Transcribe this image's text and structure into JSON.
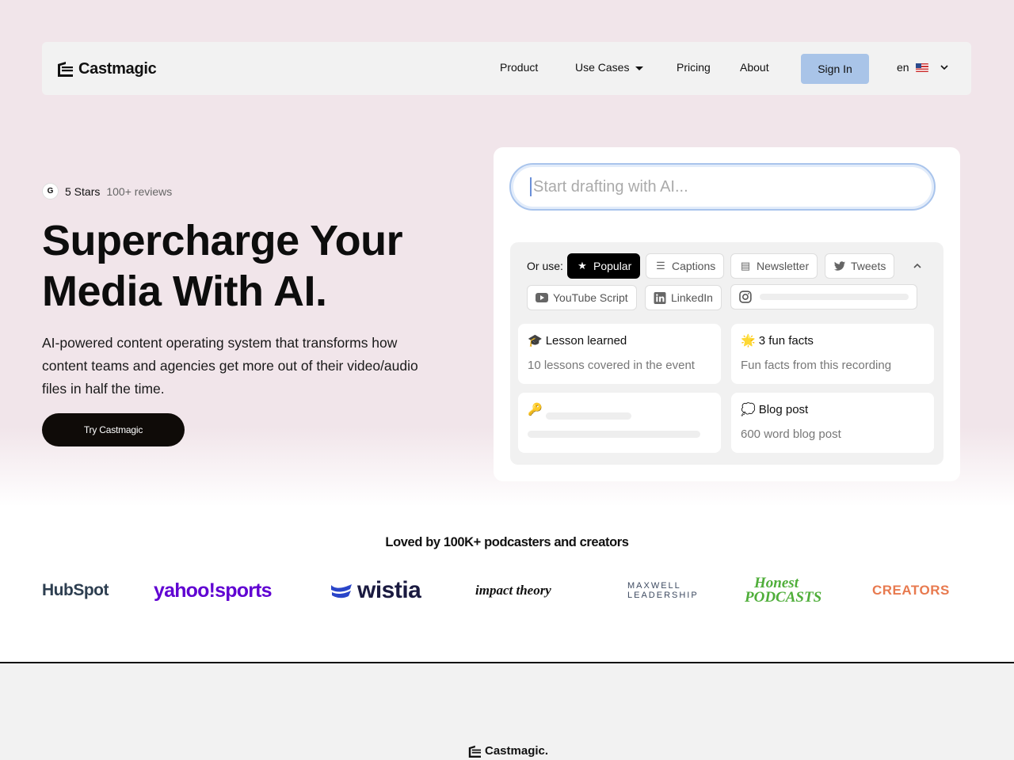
{
  "nav": {
    "logo_text": "Castmagic",
    "links": [
      "Product",
      "Use Cases",
      "Pricing",
      "About"
    ],
    "signin_label": "Sign In",
    "language": "en"
  },
  "hero": {
    "rating_badge": "G",
    "rating_stars": "5 Stars",
    "rating_reviews": "100+ reviews",
    "headline_line1": "Supercharge Your",
    "headline_line2": "Media With AI.",
    "subtext": "AI-powered content operating system that transforms how content teams and agencies get more out of their video/audio files in half the time.",
    "cta_label": "Try Castmagic"
  },
  "composer": {
    "input_placeholder": "Start drafting with AI...",
    "or_use_label": "Or use:",
    "chips": [
      {
        "label": "Popular",
        "icon": "star-icon",
        "active": true
      },
      {
        "label": "Captions",
        "icon": "lines-icon",
        "active": false
      },
      {
        "label": "Newsletter",
        "icon": "newsletter-icon",
        "active": false
      },
      {
        "label": "Tweets",
        "icon": "twitter-icon",
        "active": false
      },
      {
        "label": "YouTube Script",
        "icon": "youtube-icon",
        "active": false
      },
      {
        "label": "LinkedIn",
        "icon": "linkedin-icon",
        "active": false
      },
      {
        "label": "",
        "icon": "instagram-icon",
        "active": false
      }
    ],
    "templates": [
      {
        "emoji": "🎓",
        "title": "Lesson learned",
        "desc": "10 lessons covered in the event"
      },
      {
        "emoji": "🌟",
        "title": "3 fun facts",
        "desc": "Fun facts from this recording"
      },
      {
        "emoji": "🔑",
        "title": "",
        "desc": ""
      },
      {
        "emoji": "💭",
        "title": "Blog post",
        "desc": "600 word blog post"
      }
    ]
  },
  "social_proof": {
    "heading": "Loved by 100K+ podcasters and creators",
    "brands": [
      "HubSpot",
      "yahoo!sports",
      "wistia",
      "impact theory",
      "MAXWELL LEADERSHIP",
      "Honest PODCASTS",
      "CREATORS"
    ]
  },
  "footer": {
    "logo_text": "Castmagic."
  },
  "colors": {
    "hero_bg": "#f1e5ea",
    "signin_bg": "#a9c4e8",
    "cta_bg": "#0f0b08"
  }
}
